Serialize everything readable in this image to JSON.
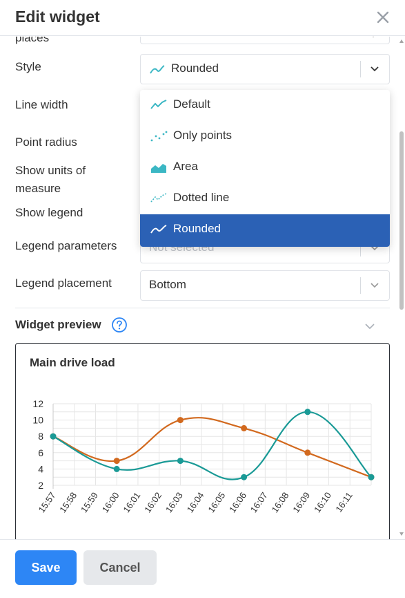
{
  "dialog": {
    "title": "Edit widget"
  },
  "form": {
    "partial_label": "places",
    "style_label": "Style",
    "style_value": "Rounded",
    "line_width_label": "Line width",
    "point_radius_label": "Point radius",
    "show_units_label_line1": "Show units of",
    "show_units_label_line2": "measure",
    "show_legend_label": "Show legend",
    "legend_params_label": "Legend parameters",
    "legend_params_value": "Not selected",
    "legend_placement_label": "Legend placement",
    "legend_placement_value": "Bottom"
  },
  "style_dropdown": {
    "options": [
      {
        "label": "Default",
        "icon": "line-chart-icon"
      },
      {
        "label": "Only points",
        "icon": "points-chart-icon"
      },
      {
        "label": "Area",
        "icon": "area-chart-icon"
      },
      {
        "label": "Dotted line",
        "icon": "dotted-line-chart-icon"
      },
      {
        "label": "Rounded",
        "icon": "rounded-line-chart-icon",
        "selected": true
      }
    ]
  },
  "preview": {
    "title": "Widget preview"
  },
  "chart_data": {
    "type": "line",
    "title": "Main drive load",
    "x": [
      "15:57",
      "15:58",
      "15:59",
      "16:00",
      "16:01",
      "16:02",
      "16:03",
      "16:04",
      "16:05",
      "16:06",
      "16:07",
      "16:08",
      "16:09",
      "16:10",
      "16:11"
    ],
    "ylim": [
      2,
      12
    ],
    "yticks": [
      2,
      4,
      6,
      8,
      10,
      12
    ],
    "grid": true,
    "smooth": true,
    "series": [
      {
        "color": "#d2691e",
        "points": [
          [
            0,
            8
          ],
          [
            3,
            5
          ],
          [
            6,
            10
          ],
          [
            9,
            9
          ],
          [
            12,
            6
          ],
          [
            15,
            3
          ]
        ]
      },
      {
        "color": "#1a9a96",
        "points": [
          [
            0,
            8
          ],
          [
            3,
            4
          ],
          [
            6,
            5
          ],
          [
            9,
            3
          ],
          [
            12,
            11
          ],
          [
            15,
            3
          ]
        ]
      }
    ]
  },
  "footer": {
    "save_label": "Save",
    "cancel_label": "Cancel"
  },
  "colors": {
    "accent": "#2d86f5",
    "selected": "#2b61b5",
    "icon_teal": "#3bb7c4"
  }
}
